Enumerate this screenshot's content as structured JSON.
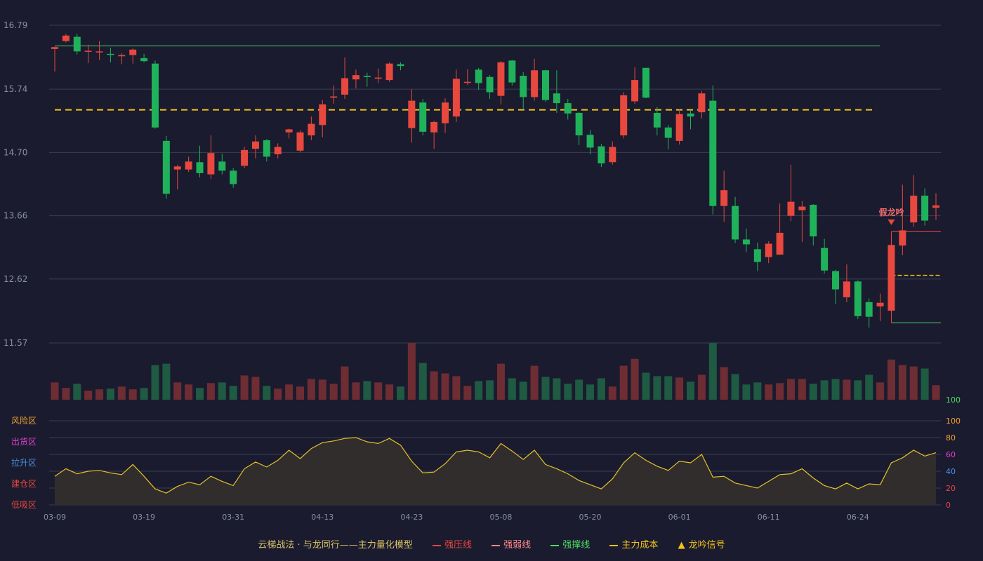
{
  "colors": {
    "up": "#e8483e",
    "down": "#1fb25a",
    "bg": "#1a1b2e",
    "grid": "#3a3d52",
    "resistance": "#e8483e",
    "weak": "#ff8a8a",
    "support": "#4cd964",
    "cost": "#f2c21a",
    "signal": "#f2c21a",
    "osc": "#e6c12a"
  },
  "chart_data": {
    "type": "candlestick",
    "price_ticks": [
      "16.79",
      "15.74",
      "14.70",
      "13.66",
      "12.62",
      "11.57"
    ],
    "price_range": [
      11.57,
      16.79
    ],
    "x_ticks": [
      {
        "i": 0,
        "label": "03-09"
      },
      {
        "i": 8,
        "label": "03-19"
      },
      {
        "i": 16,
        "label": "03-31"
      },
      {
        "i": 24,
        "label": "04-13"
      },
      {
        "i": 32,
        "label": "04-23"
      },
      {
        "i": 40,
        "label": "05-08"
      },
      {
        "i": 48,
        "label": "05-20"
      },
      {
        "i": 56,
        "label": "06-01"
      },
      {
        "i": 64,
        "label": "06-11"
      },
      {
        "i": 72,
        "label": "06-24"
      }
    ],
    "ohlc": [
      [
        16.4,
        16.43,
        16.03,
        16.44
      ],
      [
        16.53,
        16.62,
        16.51,
        16.65
      ],
      [
        16.6,
        16.36,
        16.31,
        16.65
      ],
      [
        16.36,
        16.37,
        16.17,
        16.47
      ],
      [
        16.36,
        16.36,
        16.22,
        16.53
      ],
      [
        16.32,
        16.31,
        16.18,
        16.42
      ],
      [
        16.28,
        16.3,
        16.15,
        16.33
      ],
      [
        16.3,
        16.39,
        16.16,
        16.41
      ],
      [
        16.25,
        16.2,
        16.18,
        16.32
      ],
      [
        16.16,
        15.11,
        15.09,
        16.21
      ],
      [
        14.89,
        14.02,
        13.94,
        14.97
      ],
      [
        14.42,
        14.47,
        14.09,
        14.5
      ],
      [
        14.42,
        14.55,
        14.38,
        14.63
      ],
      [
        14.54,
        14.36,
        14.29,
        14.81
      ],
      [
        14.34,
        14.69,
        14.26,
        14.98
      ],
      [
        14.55,
        14.4,
        14.34,
        14.68
      ],
      [
        14.4,
        14.18,
        14.12,
        14.44
      ],
      [
        14.48,
        14.74,
        14.44,
        14.79
      ],
      [
        14.76,
        14.88,
        14.6,
        14.98
      ],
      [
        14.9,
        14.63,
        14.55,
        14.92
      ],
      [
        14.67,
        14.79,
        14.6,
        14.85
      ],
      [
        15.03,
        15.08,
        14.93,
        15.09
      ],
      [
        14.73,
        15.03,
        14.7,
        15.06
      ],
      [
        14.98,
        15.17,
        14.9,
        15.29
      ],
      [
        15.15,
        15.49,
        14.95,
        15.56
      ],
      [
        15.6,
        15.62,
        15.5,
        15.8
      ],
      [
        15.65,
        15.92,
        15.58,
        16.26
      ],
      [
        15.9,
        15.97,
        15.75,
        16.06
      ],
      [
        15.96,
        15.94,
        15.78,
        16.01
      ],
      [
        15.93,
        15.93,
        15.84,
        16.08
      ],
      [
        15.89,
        16.16,
        15.86,
        16.18
      ],
      [
        16.15,
        16.12,
        16.05,
        16.18
      ],
      [
        15.1,
        15.55,
        14.86,
        15.74
      ],
      [
        15.52,
        15.04,
        14.98,
        15.58
      ],
      [
        15.03,
        15.2,
        14.76,
        15.22
      ],
      [
        15.18,
        15.52,
        15.02,
        15.59
      ],
      [
        15.29,
        15.91,
        15.2,
        16.06
      ],
      [
        15.85,
        15.86,
        15.81,
        16.07
      ],
      [
        16.06,
        15.84,
        15.73,
        16.09
      ],
      [
        15.94,
        15.69,
        15.58,
        15.97
      ],
      [
        15.63,
        16.18,
        15.49,
        16.2
      ],
      [
        16.21,
        15.85,
        15.8,
        16.22
      ],
      [
        15.96,
        15.61,
        15.42,
        16.02
      ],
      [
        15.61,
        16.05,
        15.55,
        16.24
      ],
      [
        16.05,
        15.56,
        15.53,
        16.06
      ],
      [
        15.67,
        15.51,
        15.35,
        16.05
      ],
      [
        15.51,
        15.34,
        15.24,
        15.58
      ],
      [
        15.35,
        14.98,
        14.82,
        15.36
      ],
      [
        14.99,
        14.78,
        14.67,
        15.07
      ],
      [
        14.8,
        14.52,
        14.46,
        14.84
      ],
      [
        14.54,
        14.79,
        14.5,
        14.88
      ],
      [
        14.98,
        15.64,
        14.93,
        15.69
      ],
      [
        15.54,
        15.89,
        15.5,
        16.1
      ],
      [
        16.09,
        15.6,
        15.59,
        16.0
      ],
      [
        15.35,
        15.11,
        14.98,
        15.45
      ],
      [
        15.11,
        14.94,
        14.75,
        15.15
      ],
      [
        14.89,
        15.33,
        14.83,
        15.41
      ],
      [
        15.34,
        15.29,
        15.08,
        15.4
      ],
      [
        15.36,
        15.67,
        15.26,
        15.71
      ],
      [
        15.55,
        13.82,
        13.68,
        15.8
      ],
      [
        13.82,
        14.08,
        13.56,
        14.4
      ],
      [
        13.82,
        13.27,
        13.21,
        13.97
      ],
      [
        13.27,
        13.19,
        13.06,
        13.45
      ],
      [
        13.11,
        12.9,
        12.75,
        13.22
      ],
      [
        12.98,
        13.2,
        12.88,
        13.24
      ],
      [
        13.02,
        13.38,
        13.02,
        13.86
      ],
      [
        13.66,
        13.89,
        13.57,
        14.5
      ],
      [
        13.75,
        13.81,
        13.23,
        13.9
      ],
      [
        13.84,
        13.32,
        13.17,
        13.85
      ],
      [
        13.13,
        12.76,
        12.71,
        13.28
      ],
      [
        12.75,
        12.45,
        12.21,
        12.77
      ],
      [
        12.32,
        12.58,
        12.24,
        12.86
      ],
      [
        12.58,
        12.01,
        11.96,
        12.6
      ],
      [
        12.24,
        12.0,
        11.82,
        12.3
      ],
      [
        12.17,
        12.23,
        11.93,
        12.38
      ],
      [
        12.1,
        13.18,
        12.08,
        13.33
      ],
      [
        13.17,
        13.42,
        13.01,
        14.17
      ],
      [
        13.55,
        13.99,
        13.48,
        14.33
      ],
      [
        13.99,
        13.58,
        13.5,
        14.11
      ],
      [
        13.79,
        13.83,
        13.59,
        14.03
      ]
    ],
    "volume": [
      50,
      34,
      46,
      26,
      30,
      32,
      38,
      30,
      34,
      100,
      104,
      50,
      44,
      34,
      48,
      50,
      40,
      70,
      66,
      40,
      32,
      44,
      38,
      60,
      58,
      46,
      96,
      50,
      54,
      50,
      44,
      38,
      164,
      106,
      82,
      76,
      68,
      40,
      54,
      56,
      104,
      62,
      52,
      98,
      66,
      62,
      46,
      58,
      44,
      62,
      38,
      98,
      118,
      78,
      68,
      68,
      64,
      52,
      72,
      164,
      94,
      74,
      44,
      50,
      44,
      48,
      60,
      60,
      46,
      56,
      60,
      58,
      56,
      72,
      50,
      116,
      100,
      96,
      90,
      42
    ],
    "oscillator": [
      34,
      43,
      37,
      40,
      41,
      38,
      36,
      48,
      34,
      19,
      14,
      22,
      27,
      24,
      34,
      28,
      23,
      43,
      51,
      45,
      53,
      65,
      55,
      67,
      74,
      76,
      79,
      80,
      75,
      73,
      79,
      71,
      52,
      38,
      39,
      49,
      63,
      65,
      63,
      56,
      73,
      64,
      54,
      65,
      48,
      43,
      37,
      29,
      24,
      19,
      31,
      50,
      62,
      53,
      46,
      41,
      52,
      50,
      60,
      33,
      34,
      26,
      23,
      20,
      28,
      36,
      37,
      43,
      32,
      23,
      19,
      26,
      19,
      25,
      24,
      50,
      56,
      65,
      58,
      62
    ],
    "osc_ticks_right": [
      "100",
      "80",
      "60",
      "40",
      "20",
      "0"
    ],
    "osc_zones": [
      {
        "label": "风险区",
        "color": "#f0a030"
      },
      {
        "label": "出货区",
        "color": "#e040d0"
      },
      {
        "label": "拉升区",
        "color": "#4a90e2"
      },
      {
        "label": "建仓区",
        "color": "#e8483e"
      },
      {
        "label": "低吸区",
        "color": "#e8483e"
      }
    ],
    "lines": {
      "resistance_top": 16.45,
      "cost_line": 15.4,
      "signal_res": 13.4,
      "signal_support": 11.9,
      "signal_cost": 12.68
    },
    "annotation": {
      "label": "假龙吟",
      "i": 75
    }
  },
  "legend": {
    "title": "云梯战法 · 与龙同行——主力量化模型",
    "items": [
      {
        "label": "强压线",
        "color": "#e8483e",
        "style": "solid"
      },
      {
        "label": "强弱线",
        "color": "#ff8a8a",
        "style": "dashed"
      },
      {
        "label": "强撑线",
        "color": "#4cd964",
        "style": "solid"
      },
      {
        "label": "主力成本",
        "color": "#f2c21a",
        "style": "dashed"
      },
      {
        "label": "龙吟信号",
        "color": "#f2c21a",
        "style": "triangle"
      }
    ]
  }
}
